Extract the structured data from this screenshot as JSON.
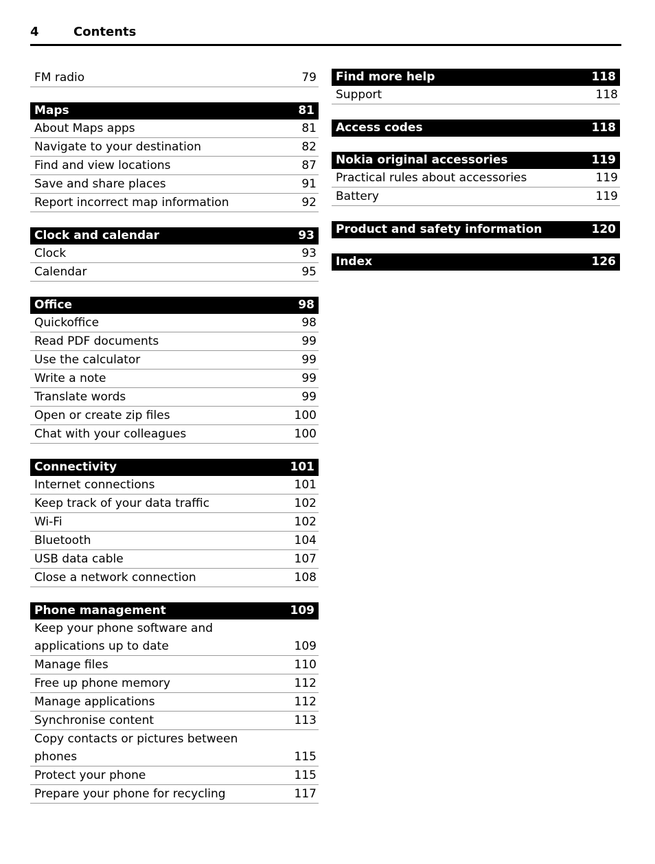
{
  "header": {
    "folio": "4",
    "title": "Contents"
  },
  "left_column": [
    {
      "type": "entries_only",
      "entries": [
        {
          "label": "FM radio",
          "page": "79",
          "wrapped": false
        }
      ]
    },
    {
      "type": "section",
      "title": "Maps",
      "page": "81",
      "entries": [
        {
          "label": "About Maps apps",
          "page": "81",
          "wrapped": false
        },
        {
          "label": "Navigate to your destination",
          "page": "82",
          "wrapped": false
        },
        {
          "label": "Find and view locations",
          "page": "87",
          "wrapped": false
        },
        {
          "label": "Save and share places",
          "page": "91",
          "wrapped": false
        },
        {
          "label": "Report incorrect map information",
          "page": "92",
          "wrapped": false
        }
      ]
    },
    {
      "type": "section",
      "title": "Clock and calendar",
      "page": "93",
      "entries": [
        {
          "label": "Clock",
          "page": "93",
          "wrapped": false
        },
        {
          "label": "Calendar",
          "page": "95",
          "wrapped": false
        }
      ]
    },
    {
      "type": "section",
      "title": "Office",
      "page": "98",
      "entries": [
        {
          "label": "Quickoffice",
          "page": "98",
          "wrapped": false
        },
        {
          "label": "Read PDF documents",
          "page": "99",
          "wrapped": false
        },
        {
          "label": "Use the calculator",
          "page": "99",
          "wrapped": false
        },
        {
          "label": "Write a note",
          "page": "99",
          "wrapped": false
        },
        {
          "label": "Translate words",
          "page": "99",
          "wrapped": false
        },
        {
          "label": "Open or create zip files",
          "page": "100",
          "wrapped": false
        },
        {
          "label": "Chat with your colleagues",
          "page": "100",
          "wrapped": false
        }
      ]
    },
    {
      "type": "section",
      "title": "Connectivity",
      "page": "101",
      "entries": [
        {
          "label": "Internet connections",
          "page": "101",
          "wrapped": false
        },
        {
          "label": "Keep track of your data traffic",
          "page": "102",
          "wrapped": false
        },
        {
          "label": "Wi-Fi",
          "page": "102",
          "wrapped": false
        },
        {
          "label": "Bluetooth",
          "page": "104",
          "wrapped": false
        },
        {
          "label": "USB data cable",
          "page": "107",
          "wrapped": false
        },
        {
          "label": "Close a network connection",
          "page": "108",
          "wrapped": false
        }
      ]
    },
    {
      "type": "section",
      "title": "Phone management",
      "page": "109",
      "entries": [
        {
          "label": "Keep your phone software and\napplications up to date",
          "page": "109",
          "wrapped": true
        },
        {
          "label": "Manage files",
          "page": "110",
          "wrapped": false
        },
        {
          "label": "Free up phone memory",
          "page": "112",
          "wrapped": false
        },
        {
          "label": "Manage applications",
          "page": "112",
          "wrapped": false
        },
        {
          "label": "Synchronise content",
          "page": "113",
          "wrapped": false
        },
        {
          "label": "Copy contacts or pictures between\nphones",
          "page": "115",
          "wrapped": true
        },
        {
          "label": "Protect your phone",
          "page": "115",
          "wrapped": false
        },
        {
          "label": "Prepare your phone for recycling",
          "page": "117",
          "wrapped": false
        }
      ]
    }
  ],
  "right_column": [
    {
      "type": "section",
      "title": "Find more help",
      "page": "118",
      "entries": [
        {
          "label": "Support",
          "page": "118",
          "wrapped": false
        }
      ]
    },
    {
      "type": "section",
      "title": "Access codes",
      "page": "118",
      "entries": []
    },
    {
      "type": "section",
      "title": "Nokia original accessories",
      "page": "119",
      "entries": [
        {
          "label": "Practical rules about accessories",
          "page": "119",
          "wrapped": false
        },
        {
          "label": "Battery",
          "page": "119",
          "wrapped": false
        }
      ]
    },
    {
      "type": "section",
      "title": "Product and safety information",
      "page": "120",
      "entries": []
    },
    {
      "type": "section",
      "title": "Index",
      "page": "126",
      "entries": []
    }
  ],
  "colors": {
    "bar_background": "#000000",
    "bar_text": "#ffffff",
    "rule": "#9a9a9a",
    "header_rule": "#000000",
    "body_text": "#000000",
    "page_background": "#ffffff"
  }
}
